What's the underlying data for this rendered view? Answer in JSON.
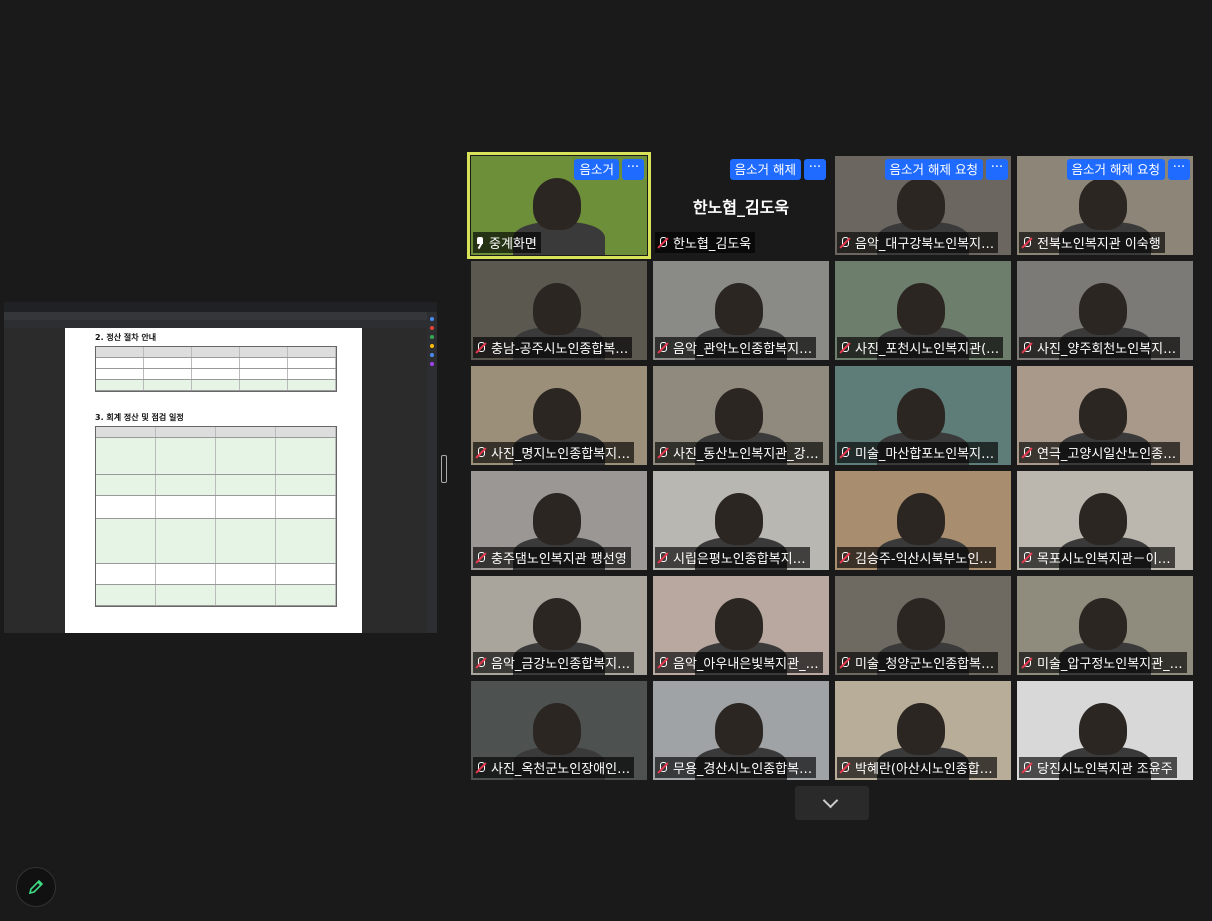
{
  "window": {
    "title": ""
  },
  "tiles": [
    {
      "name": "중계화면",
      "icon": "pin-icon",
      "buttons": [
        "음소거"
      ],
      "active": true,
      "bg": "#6e8f3a"
    },
    {
      "name": "한노협_김도욱",
      "center": "한노협_김도욱",
      "icon": "mic-off-icon",
      "buttons": [
        "음소거 해제"
      ],
      "bg": "#1a1a1a"
    },
    {
      "name": "음악_대구강북노인복지…",
      "icon": "mic-off-icon",
      "buttons": [
        "음소거 해제 요청"
      ],
      "bg": "#6b6760"
    },
    {
      "name": "전북노인복지관 이숙행",
      "icon": "mic-off-icon",
      "buttons": [
        "음소거 해제 요청"
      ],
      "bg": "#8c8578"
    },
    {
      "name": "충남-공주시노인종합복…",
      "icon": "mic-off-icon",
      "bg": "#5b5850"
    },
    {
      "name": "음악_관악노인종합복지…",
      "icon": "mic-off-icon",
      "bg": "#8a8a86"
    },
    {
      "name": "사진_포천시노인복지관(…",
      "icon": "mic-off-icon",
      "bg": "#6d7e6c"
    },
    {
      "name": "사진_양주회천노인복지…",
      "icon": "mic-off-icon",
      "bg": "#7b7a76"
    },
    {
      "name": "사진_명지노인종합복지…",
      "icon": "mic-off-icon",
      "bg": "#9b8f7a"
    },
    {
      "name": "사진_동산노인복지관_강…",
      "icon": "mic-off-icon",
      "bg": "#8f8a7d"
    },
    {
      "name": "미술_마산합포노인복지…",
      "icon": "mic-off-icon",
      "bg": "#5e7d78"
    },
    {
      "name": "연극_고양시일산노인종…",
      "icon": "mic-off-icon",
      "bg": "#a9998a"
    },
    {
      "name": "충주댐노인복지관 팽선영",
      "icon": "mic-off-icon",
      "bg": "#9a9794"
    },
    {
      "name": "시립은평노인종합복지…",
      "icon": "mic-off-icon",
      "bg": "#b9b7b1"
    },
    {
      "name": "김승주-익산시북부노인…",
      "icon": "mic-off-icon",
      "bg": "#a88e6e"
    },
    {
      "name": "목포시노인복지관－이…",
      "icon": "mic-off-icon",
      "bg": "#bcb7ae"
    },
    {
      "name": "음악_금강노인종합복지…",
      "icon": "mic-off-icon",
      "bg": "#a9a59c"
    },
    {
      "name": "음악_아우내은빛복지관_…",
      "icon": "mic-off-icon",
      "bg": "#b8a8a0"
    },
    {
      "name": "미술_청양군노인종합복…",
      "icon": "mic-off-icon",
      "bg": "#6e6a62"
    },
    {
      "name": "미술_압구정노인복지관_…",
      "icon": "mic-off-icon",
      "bg": "#8f8c7e"
    },
    {
      "name": "사진_옥천군노인장애인…",
      "icon": "mic-off-icon",
      "bg": "#4d5150"
    },
    {
      "name": "무용_경산시노인종합복…",
      "icon": "mic-off-icon",
      "bg": "#9fa3a5"
    },
    {
      "name": "박혜란(아산시노인종합…",
      "icon": "mic-off-icon",
      "bg": "#b8ad98"
    },
    {
      "name": "당진시노인복지관 조윤주",
      "icon": "mic-off-icon",
      "bg": "#d8d8d8"
    }
  ],
  "more_label": "···",
  "document": {
    "heading_1": "2. 정산 절차 안내",
    "heading_2": "3. 회계 정산 및 점검 일정"
  },
  "colors": {
    "accent": "#1f6bff",
    "active_outline": "#d9e35a",
    "mute": "#e8384f"
  }
}
